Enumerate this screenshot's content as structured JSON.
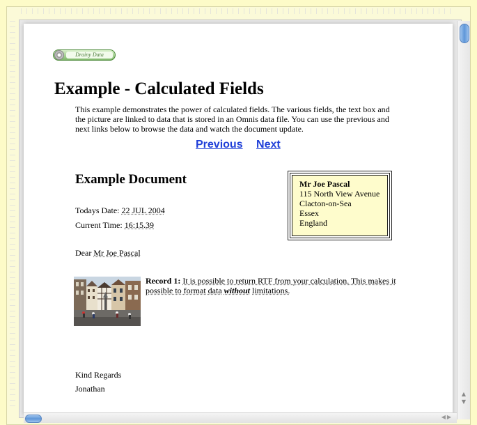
{
  "logo": {
    "text": "Drainy Data"
  },
  "title": "Example - Calculated Fields",
  "intro": "This example demonstrates the power of calculated fields. The various fields, the text box and the picture are linked to data that is stored in an Omnis data file. You can use the previous and next links below to browse the data and watch the document update.",
  "nav": {
    "previous": "Previous",
    "next": "Next"
  },
  "document": {
    "heading": "Example Document",
    "date_label": "Todays Date:",
    "date_value": "22 JUL 2004",
    "time_label": "Current Time:",
    "time_value": "16:15.39",
    "salutation_prefix": "Dear",
    "salutation_name": "Mr Joe Pascal",
    "address": {
      "name": "Mr Joe Pascal",
      "line1": "115 North View Avenue",
      "line2": "Clacton-on-Sea",
      "line3": "Essex",
      "line4": "England"
    },
    "record_label": "Record 1:",
    "record_text_1": "It is possible to return RTF from your calculation. This makes it possible to format data",
    "record_emph": "without",
    "record_text_2": "limitations.",
    "closing": "Kind Regards",
    "signature": "Jonathan"
  },
  "colors": {
    "link": "#1f3fd8",
    "address_bg": "#fefccc",
    "window_bg": "#fdfbc8"
  },
  "icons": {
    "scroll_up": "scroll-up-arrow-icon",
    "scroll_down": "scroll-down-arrow-icon",
    "scroll_left": "scroll-left-arrow-icon",
    "scroll_right": "scroll-right-arrow-icon"
  }
}
